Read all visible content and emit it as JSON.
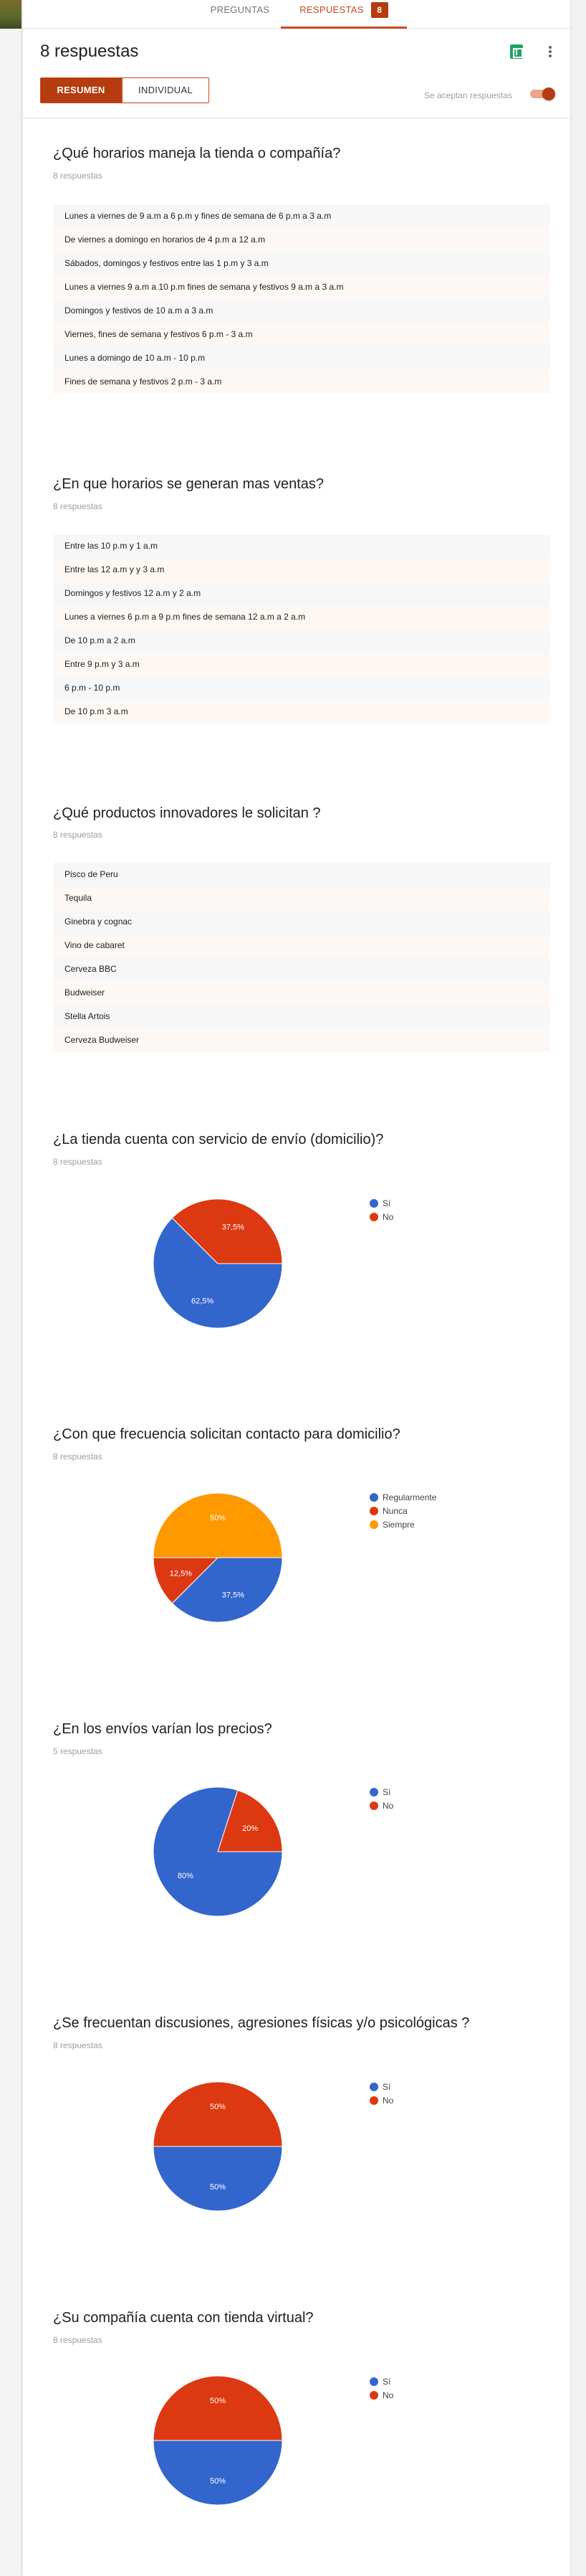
{
  "tabs": {
    "preguntas": "PREGUNTAS",
    "respuestas": "RESPUESTAS",
    "respuestas_count": "8"
  },
  "header": {
    "responses_title": "8 respuestas"
  },
  "view_toggle": {
    "resumen": "RESUMEN",
    "individual": "INDIVIDUAL"
  },
  "accepting": {
    "label": "Se aceptan respuestas",
    "enabled": true
  },
  "colors": {
    "accent": "#b43c0f",
    "blue": "#3366cc",
    "red": "#dc3912",
    "orange": "#ff9900"
  },
  "text_questions": [
    {
      "title": "¿Qué horarios maneja la tienda o compañía?",
      "count": "8 respuestas",
      "answers": [
        "Lunes a viernes de 9 a.m a 6 p.m y fines de semana de 6 p.m a 3 a.m",
        "De viernes a domingo en horarios de 4 p.m a 12 a.m",
        "Sábados, domingos y festivos entre las 1 p.m y 3 a.m",
        "Lunes a viernes 9 a.m a 10 p.m fines de semana y festivos 9 a.m a 3 a.m",
        "Domingos y festivos de 10 a.m a 3 a.m",
        "Viernes, fines de semana y festivos 6 p.m - 3 a.m",
        "Lunes a domingo de 10 a.m - 10 p.m",
        "Fines de semana y festivos 2 p.m - 3 a.m"
      ]
    },
    {
      "title": "¿En que horarios se generan mas ventas?",
      "count": "8 respuestas",
      "answers": [
        "Entre las 10 p.m y 1 a.m",
        "Entre las 12 a.m y y 3 a.m",
        "Domingos y festivos 12 a.m y 2 a.m",
        "Lunes a viernes 6 p.m a 9 p.m fines de semana 12 a.m a 2 a.m",
        "De 10 p.m a 2 a.m",
        "Entre 9 p.m y 3 a.m",
        "6 p.m - 10 p.m",
        "De 10 p.m 3 a.m"
      ]
    },
    {
      "title": "¿Qué productos innovadores le solicitan ?",
      "count": "8 respuestas",
      "answers": [
        "Pisco de Peru",
        "Tequila",
        "Ginebra y cognac",
        "Vino de cabaret",
        "Cerveza BBC",
        "Budweiser",
        "Stella Artois",
        "Cerveza Budweiser"
      ]
    }
  ],
  "chart_data": [
    {
      "type": "pie",
      "title": "¿La tienda cuenta con servicio de envío (domicilio)?",
      "count": "8 respuestas",
      "categories": [
        "Sí",
        "No"
      ],
      "values": [
        62.5,
        37.5
      ],
      "labels": [
        "62,5%",
        "37,5%"
      ],
      "colors": [
        "#3366cc",
        "#dc3912"
      ],
      "legend": "right"
    },
    {
      "type": "pie",
      "title": "¿Con que frecuencia solicitan contacto para domicilio?",
      "count": "8 respuestas",
      "categories": [
        "Regularmente",
        "Nunca",
        "Siempre"
      ],
      "values": [
        37.5,
        12.5,
        50
      ],
      "labels": [
        "37,5%",
        "12,5%",
        "50%"
      ],
      "colors": [
        "#3366cc",
        "#dc3912",
        "#ff9900"
      ],
      "legend": "right"
    },
    {
      "type": "pie",
      "title": "¿En los envíos varían los precios?",
      "count": "5 respuestas",
      "categories": [
        "Sí",
        "No"
      ],
      "values": [
        80,
        20
      ],
      "labels": [
        "80%",
        "20%"
      ],
      "colors": [
        "#3366cc",
        "#dc3912"
      ],
      "legend": "right"
    },
    {
      "type": "pie",
      "title": "¿Se frecuentan discusiones, agresiones físicas y/o psicológicas ?",
      "count": "8 respuestas",
      "categories": [
        "Sí",
        "No"
      ],
      "values": [
        50,
        50
      ],
      "labels": [
        "50%",
        "50%"
      ],
      "colors": [
        "#3366cc",
        "#dc3912"
      ],
      "legend": "right"
    },
    {
      "type": "pie",
      "title": "¿Su compañía cuenta con tienda virtual?",
      "count": "8 respuestas",
      "categories": [
        "Sí",
        "No"
      ],
      "values": [
        50,
        50
      ],
      "labels": [
        "50%",
        "50%"
      ],
      "colors": [
        "#3366cc",
        "#dc3912"
      ],
      "legend": "right"
    }
  ]
}
